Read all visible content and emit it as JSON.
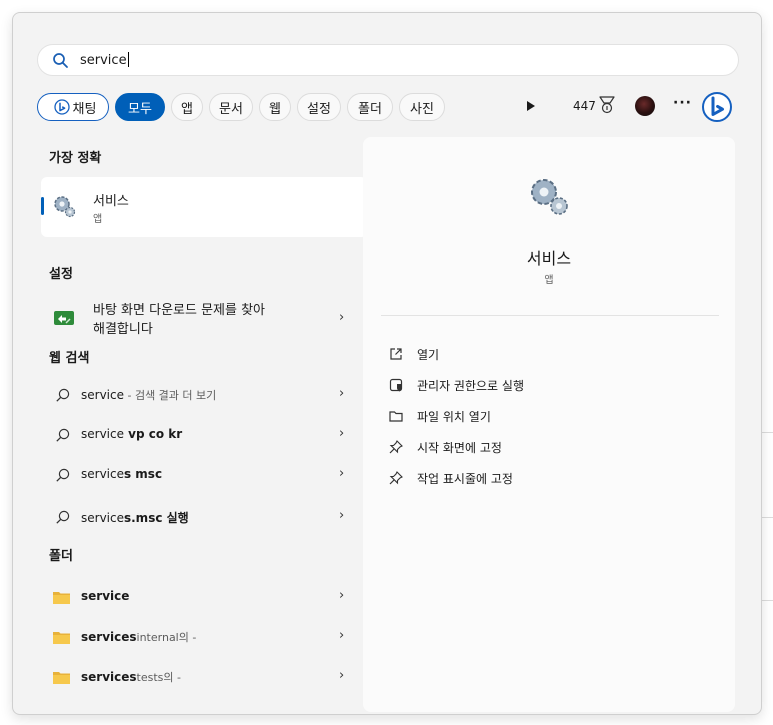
{
  "search": {
    "value": "service"
  },
  "filters": {
    "chips": [
      "채팅",
      "모두",
      "앱",
      "문서",
      "웹",
      "설정",
      "폴더",
      "사진"
    ],
    "points": "447"
  },
  "best_match": {
    "heading": "가장 정확",
    "title": "서비스",
    "subtitle": "앱"
  },
  "settings": {
    "heading": "설정",
    "item_line1": "바탕 화면 다운로드 문제를 찾아",
    "item_line2": "해결합니다"
  },
  "web": {
    "heading": "웹 검색",
    "items": [
      {
        "pre": "service",
        "bold": "",
        "dim": " - 검색 결과 더 보기"
      },
      {
        "pre": "service",
        "bold": " vp co kr",
        "dim": ""
      },
      {
        "pre": "service",
        "bold": "s msc",
        "dim": ""
      },
      {
        "pre": "service",
        "bold": "s.msc 실행",
        "dim": ""
      }
    ]
  },
  "folders": {
    "heading": "폴더",
    "items": [
      {
        "bold": "service",
        "rest": "",
        "dim": ""
      },
      {
        "bold": "services",
        "rest": "internal의",
        "dim": " -"
      },
      {
        "bold": "services",
        "rest": "tests의",
        "dim": " -"
      }
    ]
  },
  "detail": {
    "title": "서비스",
    "subtitle": "앱",
    "actions": [
      "열기",
      "관리자 권한으로 실행",
      "파일 위치 열기",
      "시작 화면에 고정",
      "작업 표시줄에 고정"
    ]
  },
  "colors": {
    "accent": "#005fb8",
    "panel": "#f3f3f3",
    "preview": "#fbfbfb"
  },
  "icons": [
    "search-icon",
    "bing-icon",
    "play-icon",
    "medal-icon",
    "avatar",
    "more-icon",
    "gear-icon",
    "troubleshoot-icon",
    "folder-icon",
    "chevron-right-icon",
    "open-icon",
    "admin-icon",
    "folder-open-icon",
    "pin-icon"
  ]
}
